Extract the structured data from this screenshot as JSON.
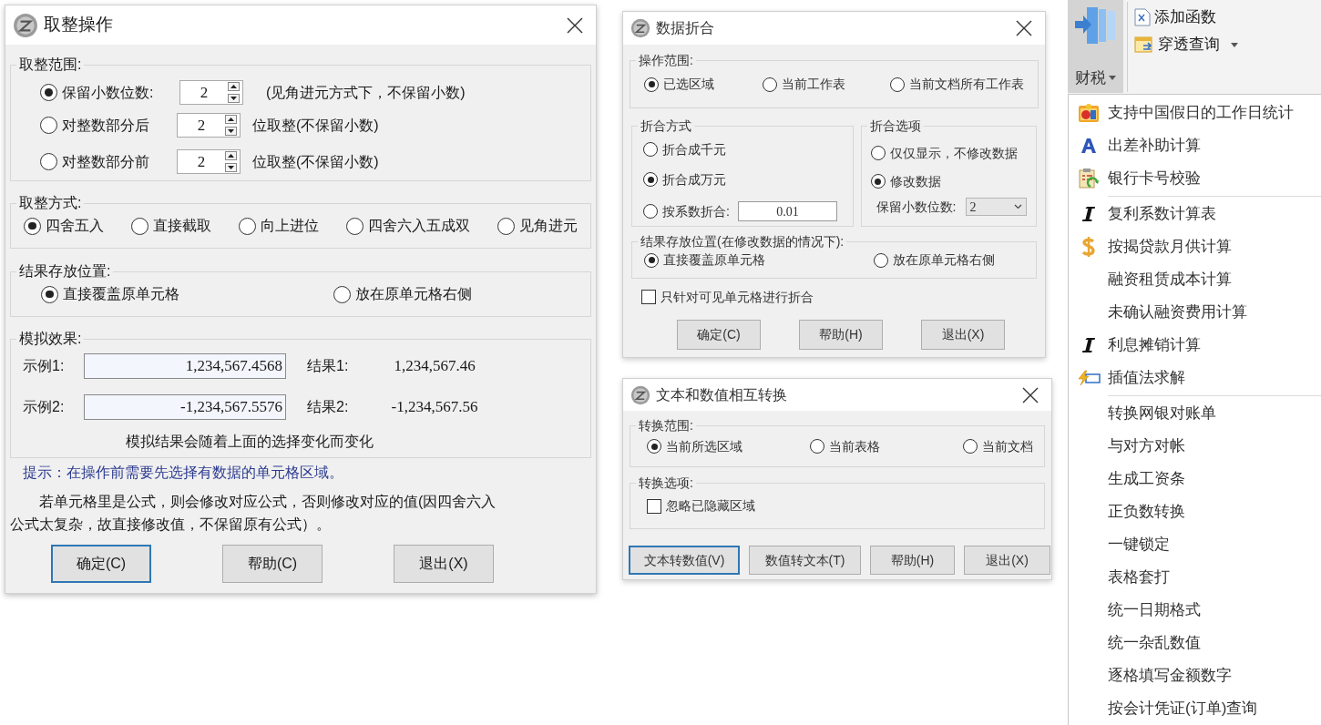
{
  "rounding_dialog": {
    "title": "取整操作",
    "range_group": {
      "label": "取整范围:",
      "options": [
        {
          "label": "保留小数位数:",
          "selected": true,
          "value": "2",
          "suffix": "(见角进元方式下，不保留小数)"
        },
        {
          "label": "对整数部分后",
          "selected": false,
          "value": "2",
          "suffix": "位取整(不保留小数)"
        },
        {
          "label": "对整数部分前",
          "selected": false,
          "value": "2",
          "suffix": "位取整(不保留小数)"
        }
      ]
    },
    "method_group": {
      "label": "取整方式:",
      "options": [
        {
          "label": "四舍五入",
          "selected": true
        },
        {
          "label": "直接截取",
          "selected": false
        },
        {
          "label": "向上进位",
          "selected": false
        },
        {
          "label": "四舍六入五成双",
          "selected": false
        },
        {
          "label": "见角进元",
          "selected": false
        }
      ]
    },
    "position_group": {
      "label": "结果存放位置:",
      "options": [
        {
          "label": "直接覆盖原单元格",
          "selected": true
        },
        {
          "label": "放在原单元格右侧",
          "selected": false
        }
      ]
    },
    "preview_group": {
      "label": "模拟效果:",
      "examples": [
        {
          "label": "示例1:",
          "value": "1,234,567.4568",
          "result_label": "结果1:",
          "result": "1,234,567.46"
        },
        {
          "label": "示例2:",
          "value": "-1,234,567.5576",
          "result_label": "结果2:",
          "result": "-1,234,567.56"
        }
      ],
      "caption": "模拟结果会随着上面的选择变化而变化"
    },
    "hint": "提示：在操作前需要先选择有数据的单元格区域。",
    "note": "若单元格里是公式，则会修改对应公式，否则修改对应的值(因四舍六入公式太复杂，故直接修改值，不保留原有公式）。",
    "buttons": [
      {
        "label": "确定(C)",
        "focused": true
      },
      {
        "label": "帮助(C)",
        "focused": false
      },
      {
        "label": "退出(X)",
        "focused": false
      }
    ]
  },
  "fold_dialog": {
    "title": "数据折合",
    "range_group": {
      "label": "操作范围:",
      "options": [
        {
          "label": "已选区域",
          "selected": true
        },
        {
          "label": "当前工作表",
          "selected": false
        },
        {
          "label": "当前文档所有工作表",
          "selected": false
        }
      ]
    },
    "method_group": {
      "label": "折合方式",
      "options": [
        {
          "label": "折合成千元",
          "selected": false
        },
        {
          "label": "折合成万元",
          "selected": true
        },
        {
          "label": "按系数折合:",
          "selected": false,
          "value": "0.01"
        }
      ]
    },
    "option_group": {
      "label": "折合选项",
      "options": [
        {
          "label": "仅仅显示，不修改数据",
          "selected": false
        },
        {
          "label": "修改数据",
          "selected": true
        }
      ],
      "decimals_label": "保留小数位数:",
      "decimals_value": "2"
    },
    "position_group": {
      "label": "结果存放位置(在修改数据的情况下):",
      "options": [
        {
          "label": "直接覆盖原单元格",
          "selected": true
        },
        {
          "label": "放在原单元格右侧",
          "selected": false
        }
      ]
    },
    "visible_only": {
      "label": "只针对可见单元格进行折合",
      "checked": false
    },
    "buttons": [
      {
        "label": "确定(C)",
        "focused": false
      },
      {
        "label": "帮助(H)",
        "focused": false
      },
      {
        "label": "退出(X)",
        "focused": false
      }
    ]
  },
  "convert_dialog": {
    "title": "文本和数值相互转换",
    "range_group": {
      "label": "转换范围:",
      "options": [
        {
          "label": "当前所选区域",
          "selected": true
        },
        {
          "label": "当前表格",
          "selected": false
        },
        {
          "label": "当前文档",
          "selected": false
        }
      ]
    },
    "option_group": {
      "label": "转换选项:",
      "ignore_hidden": {
        "label": "忽略已隐藏区域",
        "checked": false
      }
    },
    "buttons": [
      {
        "label": "文本转数值(V)",
        "focused": true
      },
      {
        "label": "数值转文本(T)",
        "focused": false
      },
      {
        "label": "帮助(H)",
        "focused": false
      },
      {
        "label": "退出(X)",
        "focused": false
      }
    ]
  },
  "ribbon": {
    "main_button": {
      "label": "财税",
      "expanded": true,
      "dropdown": true
    },
    "buttons": [
      {
        "label": "添加函数",
        "dropdown": false
      },
      {
        "label": "穿透查询",
        "dropdown": true
      }
    ]
  },
  "menu": {
    "sections": [
      [
        {
          "label": "支持中国假日的工作日统计"
        },
        {
          "label": "出差补助计算"
        },
        {
          "label": "银行卡号校验"
        }
      ],
      [
        {
          "label": "复利系数计算表"
        },
        {
          "label": "按揭贷款月供计算"
        },
        {
          "label": "融资租赁成本计算"
        },
        {
          "label": "未确认融资费用计算"
        },
        {
          "label": "利息摊销计算"
        },
        {
          "label": "插值法求解"
        }
      ],
      [
        {
          "label": "转换网银对账单"
        },
        {
          "label": "与对方对帐"
        },
        {
          "label": "生成工资条"
        },
        {
          "label": "正负数转换"
        },
        {
          "label": "一键锁定"
        },
        {
          "label": "表格套打"
        },
        {
          "label": "统一日期格式"
        },
        {
          "label": "统一杂乱数值"
        },
        {
          "label": "逐格填写金额数字"
        },
        {
          "label": "按会计凭证(订单)查询"
        }
      ]
    ]
  }
}
